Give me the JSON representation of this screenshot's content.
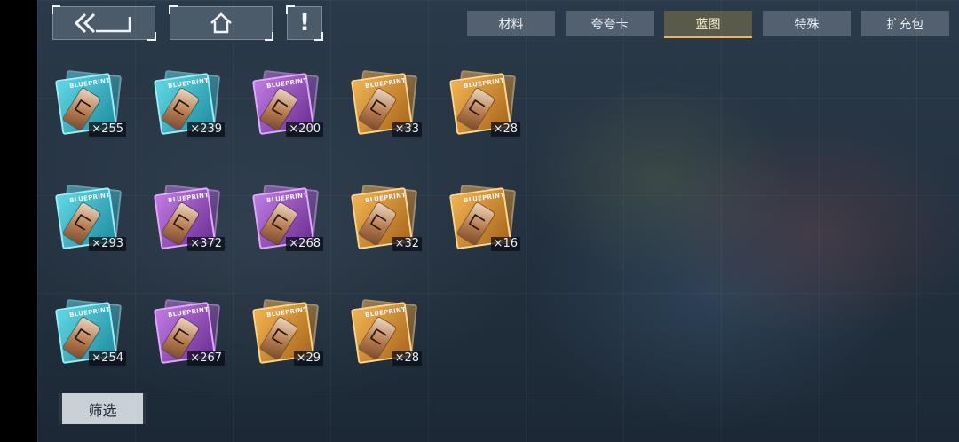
{
  "tabs": [
    "材料",
    "夸夸卡",
    "蓝图",
    "特殊",
    "扩充包"
  ],
  "active_tab": "蓝图",
  "item_label": "BLUEPRINT",
  "items": [
    {
      "count": "×255",
      "quality": "teal"
    },
    {
      "count": "×239",
      "quality": "teal"
    },
    {
      "count": "×200",
      "quality": "purple"
    },
    {
      "count": "×33",
      "quality": "gold"
    },
    {
      "count": "×28",
      "quality": "gold"
    },
    {
      "count": "×293",
      "quality": "teal"
    },
    {
      "count": "×372",
      "quality": "purple"
    },
    {
      "count": "×268",
      "quality": "purple"
    },
    {
      "count": "×32",
      "quality": "gold"
    },
    {
      "count": "×16",
      "quality": "gold"
    },
    {
      "count": "×254",
      "quality": "teal"
    },
    {
      "count": "×267",
      "quality": "purple"
    },
    {
      "count": "×29",
      "quality": "gold"
    },
    {
      "count": "×28",
      "quality": "gold"
    }
  ],
  "filter_label": "筛选",
  "icons": {
    "back": "back-arrows-icon",
    "home": "home-icon",
    "alert": "exclamation-icon"
  },
  "colors": {
    "teal": "#4fcad9",
    "purple": "#a95fd1",
    "gold": "#e7a43c",
    "active_tab": "#e7b85a"
  }
}
